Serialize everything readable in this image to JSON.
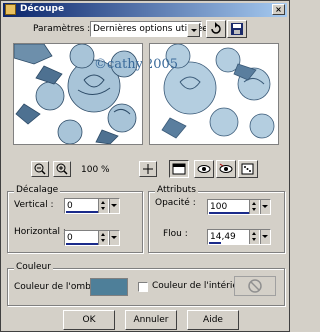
{
  "window": {
    "title": "Découpe"
  },
  "params": {
    "label": "Paramètres :",
    "preset": "Dernières options utilisées"
  },
  "preview": {
    "watermark": "©cathy2005"
  },
  "zoom": {
    "level": "100 %"
  },
  "offset": {
    "title": "Décalage",
    "vertical_label": "Vertical :",
    "vertical_value": "0",
    "horizontal_label": "Horizontal :",
    "horizontal_value": "0"
  },
  "attributes": {
    "title": "Attributs",
    "opacity_label": "Opacité :",
    "opacity_value": "100",
    "blur_label": "Flou :",
    "blur_value": "14,49"
  },
  "color": {
    "title": "Couleur",
    "shadow_label": "Couleur de l'ombre :",
    "shadow_color": "#4e7f99",
    "inside_label": "Couleur de l'intérieur :"
  },
  "buttons": {
    "ok": "OK",
    "cancel": "Annuler",
    "help": "Aide"
  }
}
